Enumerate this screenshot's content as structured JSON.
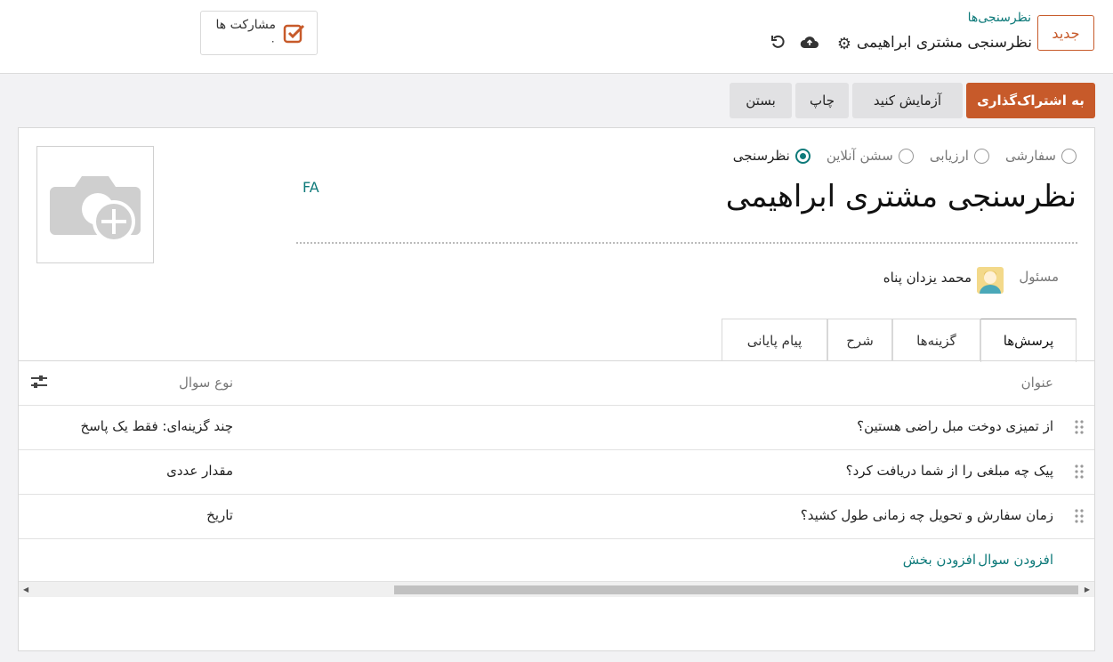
{
  "header": {
    "new_label": "جدید",
    "breadcrumb": "نظرسنجی‌ها",
    "record_title": "نظرسنجی مشتری ابراهیمی",
    "participations_label": "مشارکت ها",
    "participations_count": "۰"
  },
  "actions": {
    "share": "به اشتراک‌گذاری",
    "test": "آزمایش کنید",
    "print": "چاپ",
    "close": "بستن"
  },
  "form": {
    "types": [
      {
        "label": "نظرسنجی",
        "selected": true
      },
      {
        "label": "سشن آنلاین",
        "selected": false
      },
      {
        "label": "ارزیابی",
        "selected": false
      },
      {
        "label": "سفارشی",
        "selected": false
      }
    ],
    "title": "نظرسنجی مشتری ابراهیمی",
    "lang": "FA",
    "responsible_label": "مسئول",
    "responsible_name": "محمد یزدان پناه"
  },
  "tabs": [
    "پرسش‌ها",
    "گزینه‌ها",
    "شرح",
    "پیام پایانی"
  ],
  "table": {
    "headers": {
      "title": "عنوان",
      "type": "نوع سوال"
    },
    "rows": [
      {
        "question": "از تمیزی دوخت مبل راضی هستین؟",
        "type": "چند گزینه‌ای: فقط یک پاسخ"
      },
      {
        "question": "پیک چه مبلغی را از شما دریافت کرد؟",
        "type": "مقدار عددی"
      },
      {
        "question": "زمان سفارش و تحویل چه زمانی طول کشید؟",
        "type": "تاریخ"
      }
    ],
    "add_question": "افزودن سوال",
    "add_section": "افزودن بخش"
  },
  "colors": {
    "accent": "#c75a2a",
    "teal": "#0e7a7a"
  }
}
